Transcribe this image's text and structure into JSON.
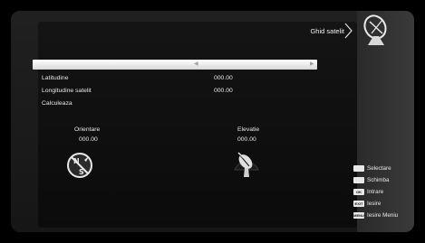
{
  "header": {
    "title": "Ghid satelit"
  },
  "fields": [
    {
      "label": "",
      "value": ""
    },
    {
      "label": "Latitudine",
      "value": "000.00"
    },
    {
      "label": "Longitudine satelit",
      "value": "000.00"
    },
    {
      "label": "Calculeaza",
      "value": ""
    }
  ],
  "orientation": {
    "label": "Orientare",
    "value": "000.00"
  },
  "elevation": {
    "label": "Elevatie",
    "value": "000.00"
  },
  "legend": [
    {
      "key": "",
      "text": "Selectare"
    },
    {
      "key": "",
      "text": "Schimba"
    },
    {
      "key": "OK",
      "text": "Intrare"
    },
    {
      "key": "EXIT",
      "text": "Iesire"
    },
    {
      "key": "MENU",
      "text": "Iesire Meniu"
    }
  ],
  "compass_letters": {
    "n": "N",
    "s": "S"
  }
}
